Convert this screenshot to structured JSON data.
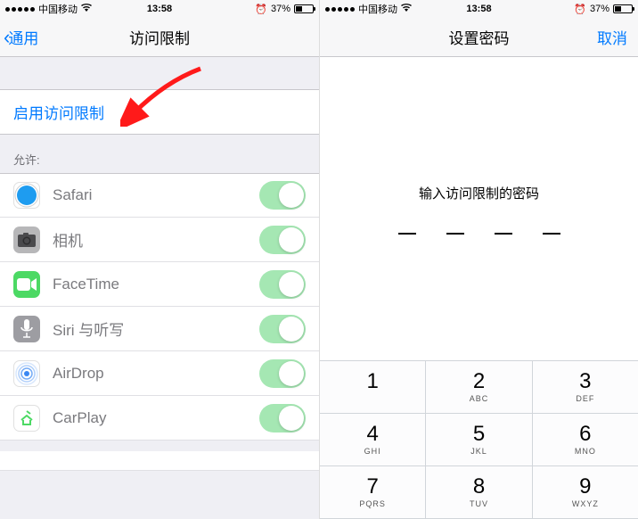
{
  "statusbar": {
    "carrier": "中国移动",
    "time": "13:58",
    "battery_pct": "37%"
  },
  "left": {
    "back_label": "通用",
    "title": "访问限制",
    "enable_label": "启用访问限制",
    "allow_header": "允许:",
    "rows": [
      {
        "label": "Safari",
        "icon": "safari-icon",
        "bg": "#ffffff",
        "svg": "safari"
      },
      {
        "label": "相机",
        "icon": "camera-icon",
        "bg": "#b7b7b9",
        "svg": "camera"
      },
      {
        "label": "FaceTime",
        "icon": "facetime-icon",
        "bg": "#4cd964",
        "svg": "facetime"
      },
      {
        "label": "Siri 与听写",
        "icon": "siri-icon",
        "bg": "#9d9da2",
        "svg": "mic"
      },
      {
        "label": "AirDrop",
        "icon": "airdrop-icon",
        "bg": "#ffffff",
        "svg": "airdrop"
      },
      {
        "label": "CarPlay",
        "icon": "carplay-icon",
        "bg": "#ffffff",
        "svg": "carplay"
      }
    ]
  },
  "right": {
    "title": "设置密码",
    "cancel": "取消",
    "prompt": "输入访问限制的密码",
    "keys": [
      {
        "n": "1",
        "l": ""
      },
      {
        "n": "2",
        "l": "ABC"
      },
      {
        "n": "3",
        "l": "DEF"
      },
      {
        "n": "4",
        "l": "GHI"
      },
      {
        "n": "5",
        "l": "JKL"
      },
      {
        "n": "6",
        "l": "MNO"
      },
      {
        "n": "7",
        "l": "PQRS"
      },
      {
        "n": "8",
        "l": "TUV"
      },
      {
        "n": "9",
        "l": "WXYZ"
      }
    ]
  }
}
